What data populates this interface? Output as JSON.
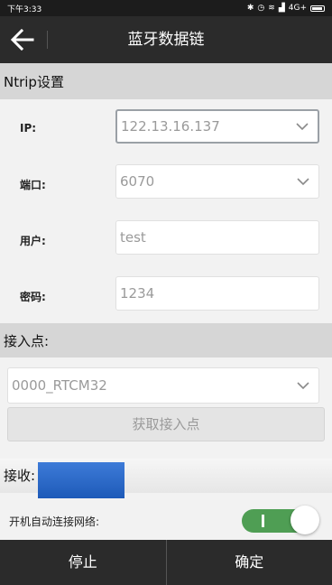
{
  "status_bar": {
    "time": "下午3:33",
    "network": "4G+"
  },
  "app_bar": {
    "title": "蓝牙数据链",
    "back_icon": "arrow-left-icon"
  },
  "ntrip": {
    "header": "Ntrip设置",
    "ip_label": "IP:",
    "ip_value": "122.13.16.137",
    "port_label": "端口:",
    "port_value": "6070",
    "user_label": "用户:",
    "user_value": "test",
    "password_label": "密码:",
    "password_value": "1234"
  },
  "access_point": {
    "header": "接入点:",
    "selected": "0000_RTCM32",
    "get_button": "获取接入点"
  },
  "receive": {
    "label": "接收:"
  },
  "auto_connect": {
    "label": "开机自动连接网络:",
    "toggle_text": "I",
    "enabled": true
  },
  "bottom_bar": {
    "stop_label": "停止",
    "confirm_label": "确定"
  },
  "colors": {
    "appbar": "#2b2b2b",
    "toggle_on": "#4f9e54",
    "receive_bar": "#2a66c4",
    "section_header": "#d6d6d6"
  }
}
